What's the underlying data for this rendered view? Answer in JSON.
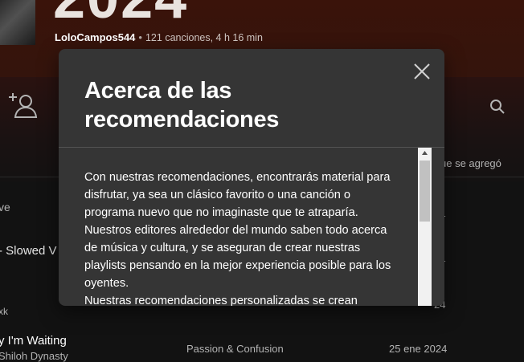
{
  "playlist": {
    "big_title": "2024",
    "owner": "LoloCampos544",
    "separator": "•",
    "stats": "121 canciones, 4 h 16 min"
  },
  "table": {
    "date_added_header": "ue se agregó",
    "rows": [
      {
        "title_fragment": "ve",
        "date_fragment": "24"
      },
      {
        "title_fragment": "- Slowed V",
        "date_fragment": "24"
      },
      {
        "title_fragment": "xk",
        "date_fragment": "24"
      },
      {
        "title_fragment": "y I'm Waiting",
        "artist_fragment": "Shiloh Dynasty",
        "album": "Passion & Confusion",
        "date": "25 ene 2024"
      }
    ]
  },
  "modal": {
    "title": "Acerca de las recomendaciones",
    "paragraphs": [
      "Con nuestras recomendaciones, encontrarás material para disfrutar, ya sea un clásico favorito o una canción o programa nuevo que no imaginaste que te atraparía. Nuestros editores alrededor del mundo saben todo acerca de música y cultura, y se aseguran de crear nuestras playlists pensando en la mejor experiencia posible para los oyentes.",
      "Nuestras recomendaciones personalizadas se crean"
    ]
  },
  "icons": {
    "close": "close-icon",
    "add_user": "add-user-icon",
    "search": "search-icon"
  },
  "colors": {
    "header_bg": "#3a130a",
    "modal_bg": "#353535",
    "page_bg": "#121212"
  }
}
